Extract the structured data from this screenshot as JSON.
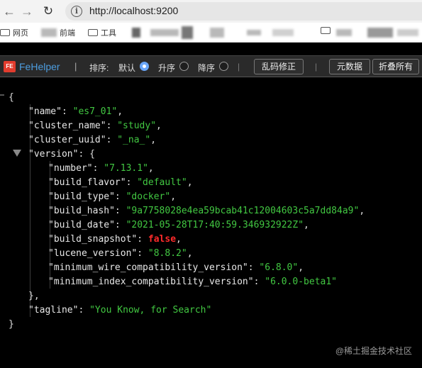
{
  "browser": {
    "back_icon": "←",
    "forward_icon": "→",
    "reload_icon": "↻",
    "url": "http://localhost:9200"
  },
  "bookmarks": [
    {
      "label": "网页"
    },
    {
      "label": "前端"
    },
    {
      "label": "工具"
    }
  ],
  "fehelper": {
    "name": "FeHelper",
    "sep": "|",
    "sort_label": "排序:",
    "opt_default": "默认",
    "opt_asc": "升序",
    "opt_desc": "降序",
    "fix_button": "乱码修正",
    "raw_button": "元数据",
    "fold_button": "折叠所有"
  },
  "json_lines": {
    "l0": "{",
    "l1_key": "\"name\"",
    "l1_val": "\"es7_01\"",
    "l2_key": "\"cluster_name\"",
    "l2_val": "\"study\"",
    "l3_key": "\"cluster_uuid\"",
    "l3_val": "\"_na_\"",
    "l4_key": "\"version\"",
    "l4_val": "{",
    "l5_key": "\"number\"",
    "l5_val": "\"7.13.1\"",
    "l6_key": "\"build_flavor\"",
    "l6_val": "\"default\"",
    "l7_key": "\"build_type\"",
    "l7_val": "\"docker\"",
    "l8_key": "\"build_hash\"",
    "l8_val": "\"9a7758028e4ea59bcab41c12004603c5a7dd84a9\"",
    "l9_key": "\"build_date\"",
    "l9_val": "\"2021-05-28T17:40:59.346932922Z\"",
    "l10_key": "\"build_snapshot\"",
    "l10_val": "false",
    "l11_key": "\"lucene_version\"",
    "l11_val": "\"8.8.2\"",
    "l12_key": "\"minimum_wire_compatibility_version\"",
    "l12_val": "\"6.8.0\"",
    "l13_key": "\"minimum_index_compatibility_version\"",
    "l13_val": "\"6.0.0-beta1\"",
    "l14": "},",
    "l15_key": "\"tagline\"",
    "l15_val": "\"You Know, for Search\"",
    "l16": "}"
  },
  "watermark": "@稀土掘金技术社区",
  "colors": {
    "string": "#42c842",
    "boolean": "#ff2b2b",
    "brand": "#4d9ddf",
    "logo": "#e23c2e"
  }
}
